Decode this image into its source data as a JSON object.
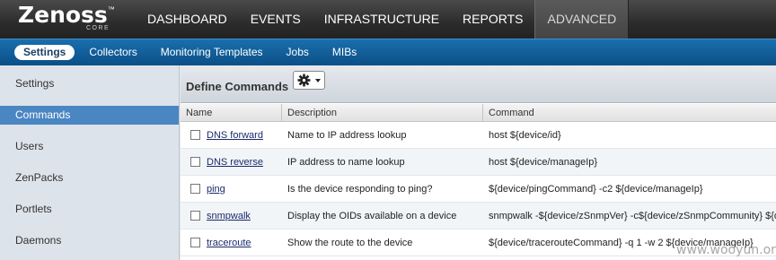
{
  "header": {
    "logo": {
      "main": "Zenoss",
      "sub": "CORE",
      "tm": "™"
    },
    "nav": [
      {
        "label": "DASHBOARD"
      },
      {
        "label": "EVENTS"
      },
      {
        "label": "INFRASTRUCTURE"
      },
      {
        "label": "REPORTS"
      },
      {
        "label": "ADVANCED",
        "active": true
      }
    ]
  },
  "subnav": [
    {
      "label": "Settings",
      "active": true
    },
    {
      "label": "Collectors"
    },
    {
      "label": "Monitoring Templates"
    },
    {
      "label": "Jobs"
    },
    {
      "label": "MIBs"
    }
  ],
  "sidebar": {
    "items": [
      {
        "label": "Settings"
      },
      {
        "label": "Commands",
        "active": true
      },
      {
        "label": "Users"
      },
      {
        "label": "ZenPacks"
      },
      {
        "label": "Portlets"
      },
      {
        "label": "Daemons"
      }
    ]
  },
  "panel": {
    "title": "Define Commands",
    "actions_icon": "gear-icon",
    "columns": [
      "Name",
      "Description",
      "Command"
    ],
    "rows": [
      {
        "name": "DNS forward",
        "description": "Name to IP address lookup",
        "command": "host ${device/id}"
      },
      {
        "name": "DNS reverse",
        "description": "IP address to name lookup",
        "command": "host ${device/manageIp}"
      },
      {
        "name": "ping",
        "description": "Is the device responding to ping?",
        "command": "${device/pingCommand} -c2 ${device/manageIp}"
      },
      {
        "name": "snmpwalk",
        "description": "Display the OIDs available on a device",
        "command": "snmpwalk -${device/zSnmpVer} -c${device/zSnmpCommunity} ${device/manageIp}"
      },
      {
        "name": "traceroute",
        "description": "Show the route to the device",
        "command": "${device/tracerouteCommand} -q 1 -w 2 ${device/manageIp}"
      }
    ]
  },
  "watermark": "www.wooyun.org",
  "colors": {
    "topbar": "#2c2c2c",
    "subbar": "#0b4f86",
    "sidebar_active": "#4a86c2",
    "link": "#1a2b6b"
  }
}
